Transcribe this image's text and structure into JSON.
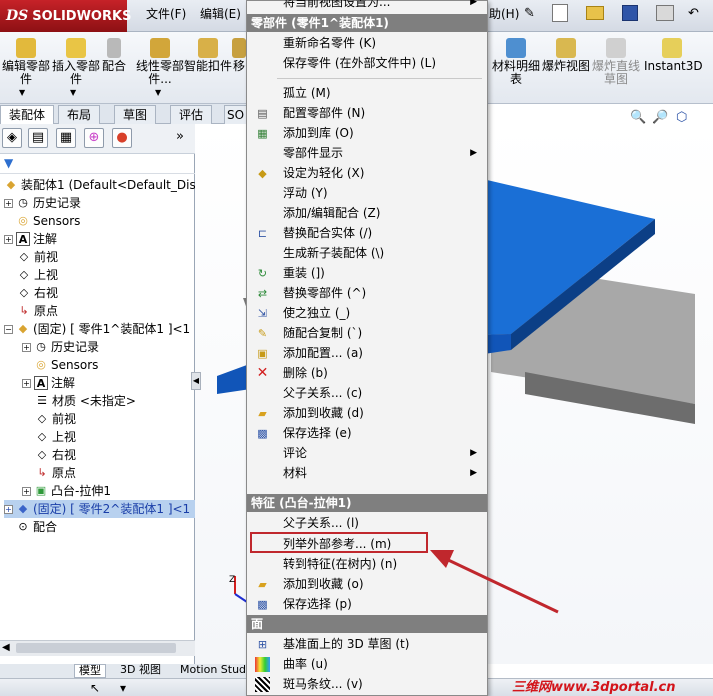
{
  "app": {
    "name": "SOLIDWORKS",
    "logo_prefix": "DS"
  },
  "menubar": {
    "file": "文件(F)",
    "edit": "编辑(E)",
    "help": "助(H)"
  },
  "ribbon": {
    "buttons": [
      {
        "label": "编辑零部件"
      },
      {
        "label": "插入零部件"
      },
      {
        "label": "配合"
      },
      {
        "label": "线性零部件..."
      },
      {
        "label": "智能扣件"
      },
      {
        "label": "移"
      }
    ],
    "right_buttons": [
      {
        "label": "材料明细表"
      },
      {
        "label": "爆炸视图"
      },
      {
        "label": "爆炸直线草图"
      },
      {
        "label": "Instant3D"
      }
    ]
  },
  "tabs": [
    "装配体",
    "布局",
    "草图",
    "评估",
    "SO"
  ],
  "tree": {
    "nodes": [
      {
        "label": "装配体1  (Default<Default_Disp",
        "icon": "assembly-icon"
      },
      {
        "label": "历史记录",
        "icon": "history-icon"
      },
      {
        "label": "Sensors",
        "icon": "sensor-icon"
      },
      {
        "label": "注解",
        "icon": "annotation-icon"
      },
      {
        "label": "前视",
        "icon": "plane-icon"
      },
      {
        "label": "上视",
        "icon": "plane-icon"
      },
      {
        "label": "右视",
        "icon": "plane-icon"
      },
      {
        "label": "原点",
        "icon": "origin-icon"
      },
      {
        "label": "(固定) [ 零件1^装配体1 ]<1",
        "icon": "part-icon"
      },
      {
        "label": "历史记录",
        "icon": "history-icon"
      },
      {
        "label": "Sensors",
        "icon": "sensor-icon"
      },
      {
        "label": "注解",
        "icon": "annotation-icon"
      },
      {
        "label": "材质 <未指定>",
        "icon": "material-icon"
      },
      {
        "label": "前视",
        "icon": "plane-icon"
      },
      {
        "label": "上视",
        "icon": "plane-icon"
      },
      {
        "label": "右视",
        "icon": "plane-icon"
      },
      {
        "label": "原点",
        "icon": "origin-icon"
      },
      {
        "label": "凸台-拉伸1",
        "icon": "extrude-icon"
      },
      {
        "label": "(固定) [ 零件2^装配体1 ]<1",
        "icon": "part-icon"
      },
      {
        "label": "配合",
        "icon": "mate-icon"
      }
    ]
  },
  "bottom_tabs": [
    "模型",
    "3D 视图",
    "Motion Stud"
  ],
  "context_menu": {
    "top_item": "将当前视图设置为...",
    "section_part": "零部件 (零件1^装配体1)",
    "part_items": [
      {
        "label": "重新命名零件 (K)",
        "icon": ""
      },
      {
        "label": "保存零件 (在外部文件中) (L)",
        "icon": ""
      },
      {
        "label": "孤立 (M)",
        "icon": ""
      },
      {
        "label": "配置零部件 (N)",
        "icon": "config-icon"
      },
      {
        "label": "添加到库 (O)",
        "icon": "library-icon"
      },
      {
        "label": "零部件显示",
        "icon": "",
        "submenu": true
      },
      {
        "label": "设定为轻化 (X)",
        "icon": "lightweight-icon"
      },
      {
        "label": "浮动 (Y)",
        "icon": ""
      },
      {
        "label": "添加/编辑配合 (Z)",
        "icon": ""
      },
      {
        "label": "替换配合实体 (/)",
        "icon": "replace-mate-icon"
      },
      {
        "label": "生成新子装配体 (\\)",
        "icon": ""
      },
      {
        "label": "重装 (])",
        "icon": "reload-icon"
      },
      {
        "label": "替换零部件 (^)",
        "icon": "replace-part-icon"
      },
      {
        "label": "使之独立 (_)",
        "icon": "independent-icon"
      },
      {
        "label": "随配合复制 (`)",
        "icon": "copy-mate-icon"
      },
      {
        "label": "添加配置... (a)",
        "icon": "add-config-icon"
      },
      {
        "label": "删除 (b)",
        "icon": "delete-icon"
      },
      {
        "label": "父子关系... (c)",
        "icon": ""
      },
      {
        "label": "添加到收藏 (d)",
        "icon": "favorite-icon"
      },
      {
        "label": "保存选择 (e)",
        "icon": "save-selection-icon"
      },
      {
        "label": "评论",
        "icon": "",
        "submenu": true
      },
      {
        "label": "材料",
        "icon": "",
        "submenu": true
      }
    ],
    "section_feature": "特征 (凸台-拉伸1)",
    "feature_items": [
      {
        "label": "父子关系... (l)",
        "icon": ""
      },
      {
        "label": "列举外部参考... (m)",
        "icon": ""
      },
      {
        "label": "转到特征(在树内) (n)",
        "icon": ""
      },
      {
        "label": "添加到收藏 (o)",
        "icon": "favorite-icon"
      },
      {
        "label": "保存选择 (p)",
        "icon": "save-selection-icon"
      }
    ],
    "section_face": "面",
    "face_items": [
      {
        "label": "基准面上的 3D 草图 (t)",
        "icon": "sketch3d-icon"
      },
      {
        "label": "曲率 (u)",
        "icon": "curvature-icon"
      },
      {
        "label": "斑马条纹... (v)",
        "icon": "zebra-icon"
      }
    ]
  },
  "watermark": "三维网www.3dportal.cn",
  "colors": {
    "part_blue": "#1a6fd6",
    "part_gray": "#9a9a9a",
    "highlight": "#c0272d",
    "accent": "#c62228"
  }
}
